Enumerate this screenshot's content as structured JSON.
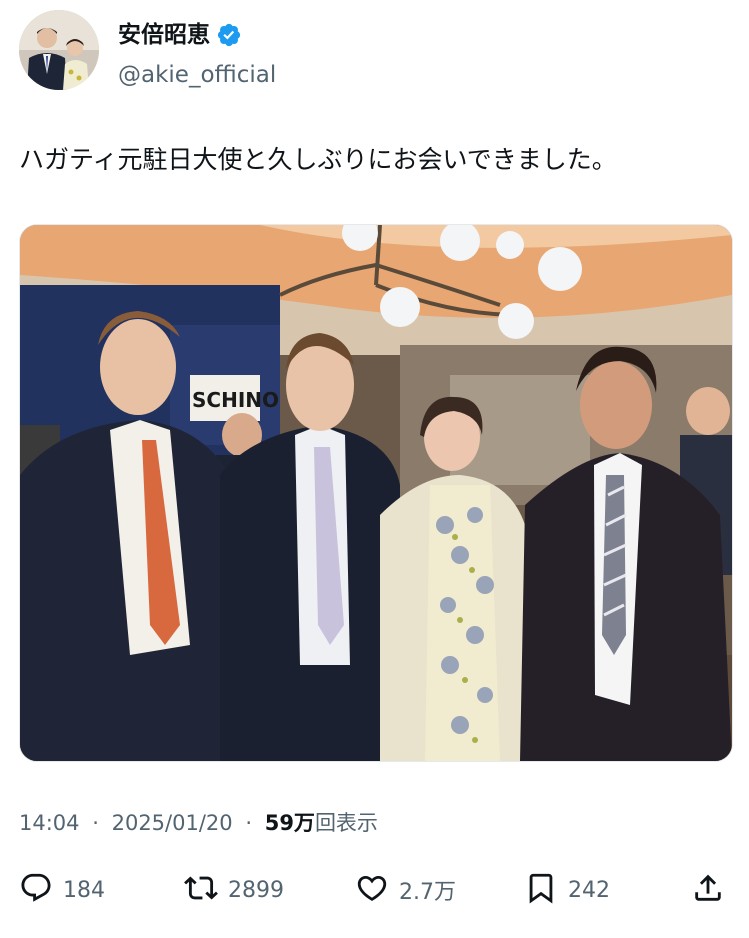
{
  "author": {
    "display_name": "安倍昭恵",
    "handle": "@akie_official",
    "verified_icon": "verified-badge-icon",
    "badge_color": "#1d9bf0"
  },
  "tweet": {
    "text": "ハガティ元駐日大使と久しぶりにお会いできました。",
    "time": "14:04",
    "date": "2025/01/20",
    "views_number": "59万",
    "views_label": "回表示",
    "separator": "·"
  },
  "actions": {
    "replies": {
      "icon": "reply-icon",
      "count": "184"
    },
    "reposts": {
      "icon": "repost-icon",
      "count": "2899"
    },
    "likes": {
      "icon": "heart-icon",
      "count": "2.7万"
    },
    "bookmarks": {
      "icon": "bookmark-icon",
      "count": "242"
    },
    "share": {
      "icon": "share-icon"
    }
  },
  "media": {
    "sign_text": "SCHINO"
  },
  "colors": {
    "text_primary": "#0f1419",
    "text_secondary": "#536471",
    "accent": "#1d9bf0"
  }
}
